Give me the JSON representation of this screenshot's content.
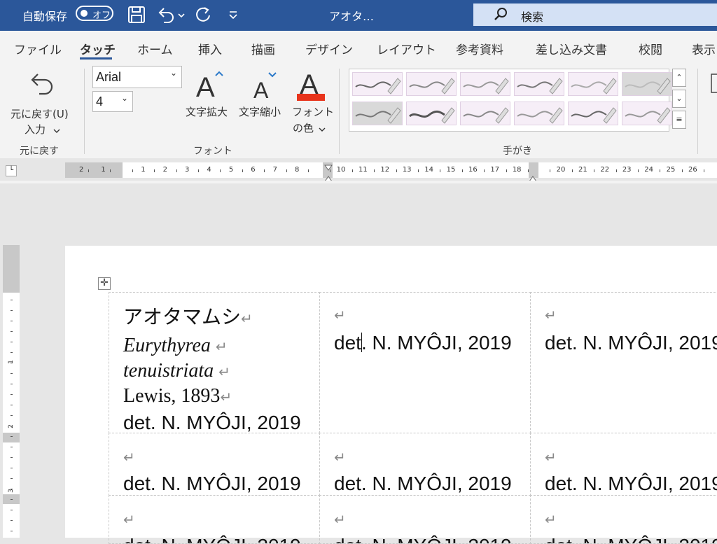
{
  "titlebar": {
    "autosave_label": "自動保存",
    "autosave_state": "オフ",
    "doc_title": "アオタ…",
    "search_label": "検索"
  },
  "tabs": [
    {
      "label": "ファイル"
    },
    {
      "label": "タッチ",
      "active": true
    },
    {
      "label": "ホーム"
    },
    {
      "label": "挿入"
    },
    {
      "label": "描画"
    },
    {
      "label": "デザイン"
    },
    {
      "label": "レイアウト"
    },
    {
      "label": "参考資料"
    },
    {
      "label": "差し込み文書"
    },
    {
      "label": "校閲"
    },
    {
      "label": "表示"
    }
  ],
  "ribbon": {
    "undo": {
      "label_line1": "元に戻す(U)",
      "label_line2": "入力",
      "group": "元に戻す"
    },
    "font": {
      "font_name": "Arial",
      "font_size": "4",
      "grow_label": "文字拡大",
      "shrink_label": "文字縮小",
      "color_label_line1": "フォント",
      "color_label_line2": "の色",
      "group": "フォント",
      "font_color": "#e8341c"
    },
    "pens": {
      "group": "手がき"
    }
  },
  "ruler": {
    "left_numbers": [
      "2",
      "1"
    ],
    "right_numbers": [
      "1",
      "2",
      "3",
      "4",
      "5",
      "6",
      "7",
      "8",
      "10",
      "11",
      "12",
      "13",
      "14",
      "15",
      "16",
      "17",
      "18",
      "20",
      "21",
      "22",
      "23",
      "24",
      "25",
      "26"
    ]
  },
  "vruler": {
    "numbers": [
      "1",
      "2",
      "3"
    ]
  },
  "document": {
    "first_cell": {
      "line_kana": "アオタマムシ",
      "line_genus": "Eurythyrea",
      "line_species": "tenuistriata",
      "line_author": "Lewis, 1893",
      "line_det": "det. N. MYÔJI, 2019"
    },
    "det_prefix": "det",
    "det_suffix": ". N. MYÔJI, 2019",
    "det_text": "det. N. MYÔJI, 2019",
    "return_mark": "↵"
  },
  "colors": {
    "accent": "#2b579a",
    "search_bg": "#d4e1f5",
    "font_color_bar": "#e8341c"
  }
}
